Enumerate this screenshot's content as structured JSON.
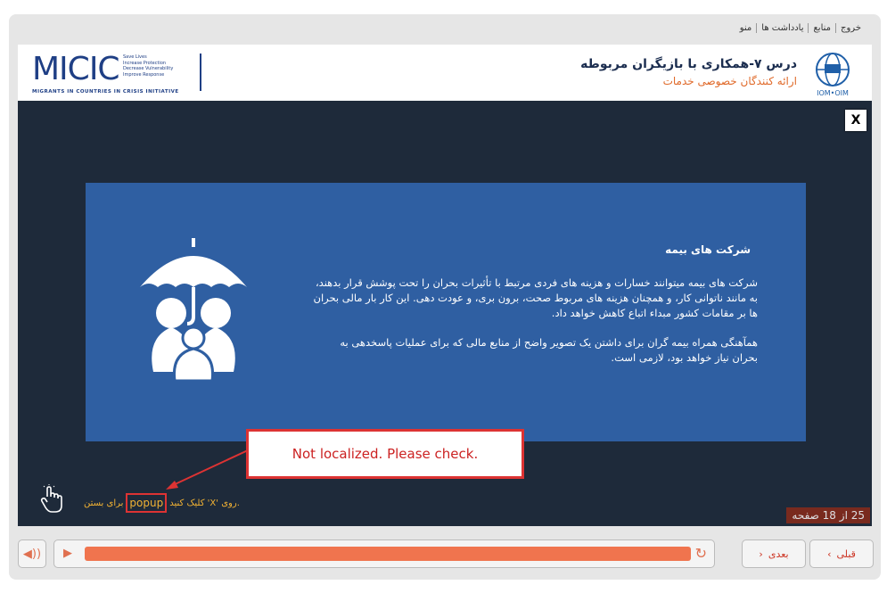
{
  "topnav": [
    "خروج",
    "منابع",
    "یادداشت ها",
    "منو"
  ],
  "header": {
    "logo_big": "MICIC",
    "logo_small": [
      "Save Lives",
      "Increase Protection",
      "Decrease Vulnerability",
      "Improve Response"
    ],
    "logo_sub": "MIGRANTS IN COUNTRIES IN CRISIS INITIATIVE",
    "lesson_title": "درس ۷-همکاری با بازیگران مربوطه",
    "lesson_subtitle": "ارائه کنندگان خصوصی خدمات",
    "iom_label": "IOM•OIM"
  },
  "stage": {
    "close_label": "X",
    "popup": {
      "title": "شرکت های بیمه",
      "para1": "شرکت های بیمه میتوانند خسارات و هزینه های فردی مرتبط با تأثیرات بحران را تحت پوشش قرار بدهند، به مانند ناتوانی کار، و همچنان هزینه های مربوط صحت، برون بری، و عودت دهی. این کار بار مالی بحران ها بر مقامات کشور مبداء اتباع کاهش خواهد داد.",
      "para2": "همآهنگی همراه بیمه گران برای داشتن یک تصویر واضح از منابع مالی که برای عملیات پاسخدهی به بحران نیاز خواهد بود، لازمی است."
    },
    "note": "Not localized. Please check.",
    "instruction": {
      "part1": "برای بستن",
      "popup_word": "popup",
      "part2": "کلیک کنید 'X' روی."
    },
    "page_counter": "25 از 18 صفحه"
  },
  "controls": {
    "next_label": "بعدی",
    "prev_label": "قبلی",
    "progress": 1.0
  },
  "colors": {
    "popup_bg": "#2f5fa2",
    "progress": "#f0744e",
    "accent": "#e06a2a"
  }
}
